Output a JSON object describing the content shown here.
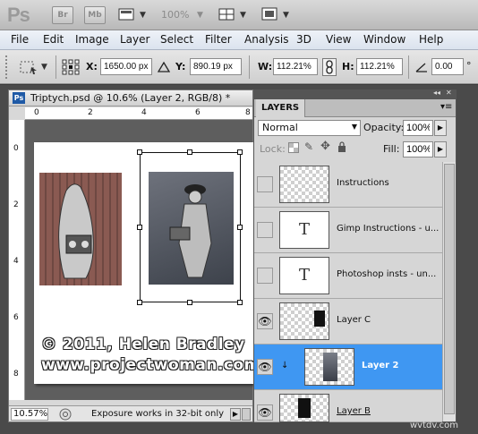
{
  "app": {
    "logo": "Ps"
  },
  "appbar": {
    "bridge_label": "Br",
    "minibridge_label": "Mb",
    "zoom_label": "100%"
  },
  "menu": [
    "File",
    "Edit",
    "Image",
    "Layer",
    "Select",
    "Filter",
    "Analysis",
    "3D",
    "View",
    "Window",
    "Help"
  ],
  "options": {
    "x_label": "X:",
    "x_value": "1650.00 px",
    "y_label": "Y:",
    "y_value": "890.19 px",
    "w_label": "W:",
    "w_value": "112.21%",
    "h_label": "H:",
    "h_value": "112.21%",
    "angle_value": "0.00"
  },
  "document": {
    "title": "Triptych.psd @ 10.6% (Layer 2, RGB/8) *",
    "ruler_top": [
      "0",
      "2",
      "4",
      "6",
      "8"
    ],
    "ruler_left": [
      "0",
      "2",
      "4",
      "6",
      "8"
    ],
    "watermark_line1": "© 2011, Helen Bradley",
    "watermark_line2": "www.projectwoman.com",
    "status_zoom": "10.57%",
    "status_text": "Exposure works in 32-bit only"
  },
  "layers_panel": {
    "tab": "LAYERS",
    "blend_mode": "Normal",
    "opacity_label": "Opacity:",
    "opacity_value": "100%",
    "lock_label": "Lock:",
    "fill_label": "Fill:",
    "fill_value": "100%",
    "layers": [
      {
        "name": "Instructions",
        "type": "image",
        "visible": false,
        "selected": false
      },
      {
        "name": "Gimp Instructions - u...",
        "type": "text",
        "visible": false,
        "selected": false
      },
      {
        "name": "Photoshop insts - un...",
        "type": "text",
        "visible": false,
        "selected": false
      },
      {
        "name": "Layer C",
        "type": "image",
        "visible": true,
        "selected": false
      },
      {
        "name": "Layer 2",
        "type": "image",
        "visible": true,
        "selected": true
      },
      {
        "name": "Layer B",
        "type": "image",
        "visible": true,
        "selected": false
      }
    ]
  },
  "credit": "wvtdv.com",
  "colors": {
    "selection": "#3f97f2",
    "ps_badge": "#1f5aa6"
  }
}
